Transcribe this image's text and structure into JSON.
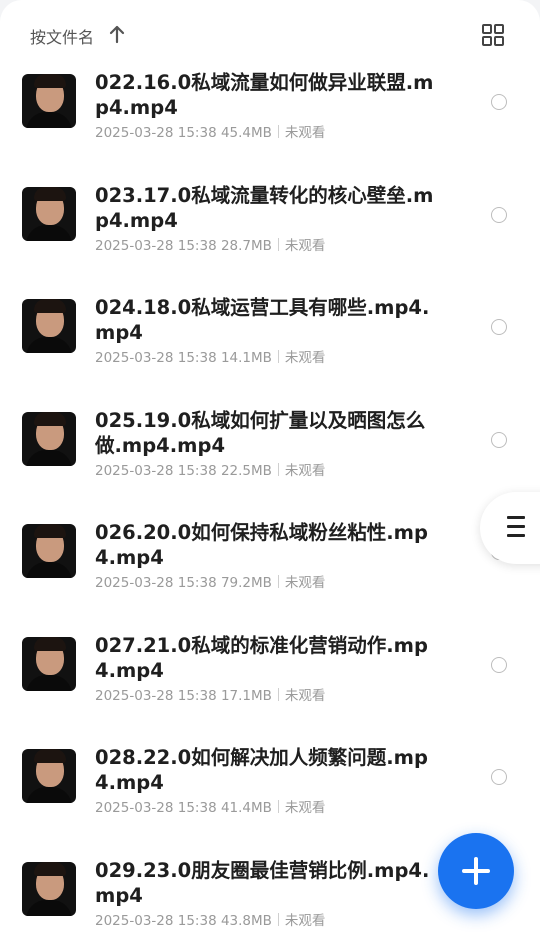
{
  "toolbar": {
    "sort_label": "按文件名",
    "sort_icon": "arrow-up-icon",
    "view_icon": "grid-view-icon"
  },
  "files": [
    {
      "title": "022.16.0私域流量如何做异业联盟.mp4.mp4",
      "date": "2025-03-28 15:38",
      "size": "45.4MB",
      "status": "未观看"
    },
    {
      "title": "023.17.0私域流量转化的核心壁垒.mp4.mp4",
      "date": "2025-03-28 15:38",
      "size": "28.7MB",
      "status": "未观看"
    },
    {
      "title": "024.18.0私域运营工具有哪些.mp4.mp4",
      "date": "2025-03-28 15:38",
      "size": "14.1MB",
      "status": "未观看"
    },
    {
      "title": "025.19.0私域如何扩量以及晒图怎么做.mp4.mp4",
      "date": "2025-03-28 15:38",
      "size": "22.5MB",
      "status": "未观看"
    },
    {
      "title": "026.20.0如何保持私域粉丝粘性.mp4.mp4",
      "date": "2025-03-28 15:38",
      "size": "79.2MB",
      "status": "未观看"
    },
    {
      "title": "027.21.0私域的标准化营销动作.mp4.mp4",
      "date": "2025-03-28 15:38",
      "size": "17.1MB",
      "status": "未观看"
    },
    {
      "title": "028.22.0如何解决加人频繁问题.mp4.mp4",
      "date": "2025-03-28 15:38",
      "size": "41.4MB",
      "status": "未观看"
    },
    {
      "title": "029.23.0朋友圈最佳营销比例.mp4.mp4",
      "date": "2025-03-28 15:38",
      "size": "43.8MB",
      "status": "未观看"
    }
  ],
  "side_tab_icon": "menu-icon",
  "fab_icon": "plus-icon",
  "colors": {
    "accent": "#1a73f0",
    "title": "#1f1f1f",
    "meta": "#9a9a9a"
  }
}
